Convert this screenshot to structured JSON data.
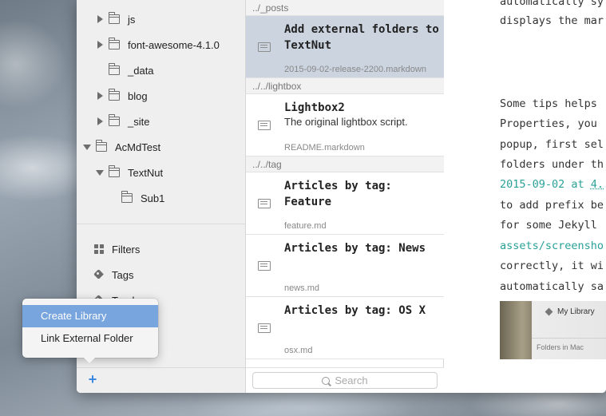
{
  "sidebar": {
    "tree": [
      {
        "label": "js",
        "expanded": false,
        "hasChildren": true,
        "depth": 1
      },
      {
        "label": "font-awesome-4.1.0",
        "expanded": false,
        "hasChildren": true,
        "depth": 1
      },
      {
        "label": "_data",
        "expanded": false,
        "hasChildren": false,
        "depth": 1
      },
      {
        "label": "blog",
        "expanded": false,
        "hasChildren": true,
        "depth": 1
      },
      {
        "label": "_site",
        "expanded": false,
        "hasChildren": true,
        "depth": 1
      },
      {
        "label": "AcMdTest",
        "expanded": true,
        "hasChildren": true,
        "depth": 0
      },
      {
        "label": "TextNut",
        "expanded": true,
        "hasChildren": true,
        "depth": 1
      },
      {
        "label": "Sub1",
        "expanded": false,
        "hasChildren": false,
        "depth": 2
      }
    ],
    "nav": {
      "filters": "Filters",
      "tags": "Tags",
      "trash": "Trash"
    },
    "add_button": "+"
  },
  "popup_menu": {
    "items": [
      {
        "label": "Create Library",
        "highlighted": true
      },
      {
        "label": "Link External Folder",
        "highlighted": false
      }
    ]
  },
  "notelist": {
    "groups": [
      {
        "header": "../_posts",
        "notes": [
          {
            "title": "Add external folders to\nTextNut",
            "subtitle": "",
            "file": "2015-09-02-release-2200.markdown",
            "selected": true
          }
        ]
      },
      {
        "header": "../../lightbox",
        "notes": [
          {
            "title": "Lightbox2",
            "subtitle": "The original lightbox script.",
            "file": "README.markdown",
            "selected": false
          }
        ]
      },
      {
        "header": "../../tag",
        "notes": [
          {
            "title": "Articles by tag:\nFeature",
            "subtitle": "",
            "file": "feature.md",
            "selected": false
          },
          {
            "title": "Articles by tag: News",
            "subtitle": "",
            "file": "news.md",
            "selected": false
          },
          {
            "title": "Articles by tag: OS X",
            "subtitle": "",
            "file": "osx.md",
            "selected": false
          }
        ]
      }
    ],
    "search_placeholder": "Search"
  },
  "editor": {
    "lines": [
      {
        "text": "automatically sy",
        "style": "normal"
      },
      {
        "text": "displays the mar",
        "style": "normal"
      },
      {
        "text": "Some tips helps",
        "style": "normal"
      },
      {
        "text": "Properties, you",
        "style": "normal"
      },
      {
        "text": "popup, first sel",
        "style": "normal"
      },
      {
        "text": "folders under th",
        "style": "normal"
      },
      {
        "text": "2015-09-02 at ",
        "style": "green",
        "link": "4."
      },
      {
        "text": "to add prefix be",
        "style": "normal"
      },
      {
        "text": "for some Jekyll",
        "style": "normal"
      },
      {
        "text": "assets/screensho",
        "style": "green"
      },
      {
        "text": "correctly, it wi",
        "style": "normal"
      },
      {
        "text": "automatically sa",
        "style": "normal"
      }
    ],
    "image": {
      "library_label": "My Library",
      "folders_label": "Folders in Mac"
    }
  }
}
